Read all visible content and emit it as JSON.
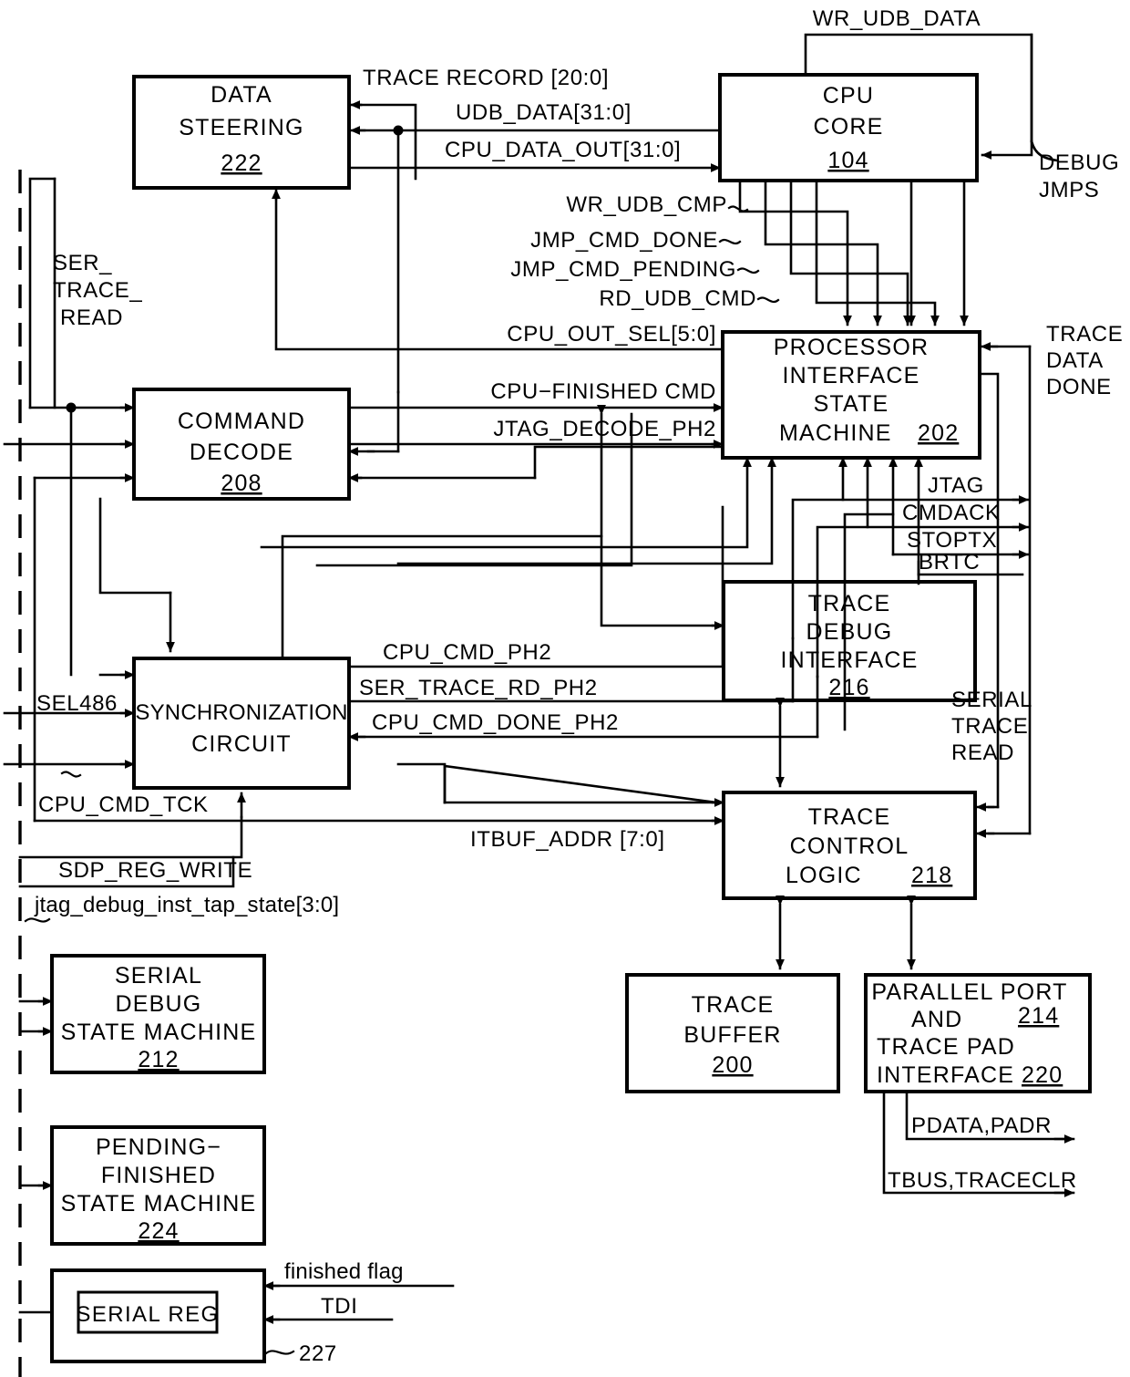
{
  "figure": {
    "title": "Processor debug and trace interface block diagram"
  },
  "blocks": {
    "data_steering": {
      "l1": "DATA",
      "l2": "STEERING",
      "num": "222"
    },
    "cpu_core": {
      "l1": "CPU",
      "l2": "CORE",
      "num": "104"
    },
    "command_decode": {
      "l1": "COMMAND",
      "l2": "DECODE",
      "num": "208"
    },
    "pism": {
      "l1": "PROCESSOR",
      "l2": "INTERFACE",
      "l3": "STATE",
      "l4": "MACHINE",
      "num": "202"
    },
    "sync_circuit": {
      "l1": "SYNCHRONIZATION",
      "l2": "CIRCUIT"
    },
    "trace_debug_if": {
      "l1": "TRACE",
      "l2": "DEBUG",
      "l3": "INTERFACE",
      "num": "216"
    },
    "trace_ctrl_logic": {
      "l1": "TRACE",
      "l2": "CONTROL",
      "l3": "LOGIC",
      "num": "218"
    },
    "trace_buffer": {
      "l1": "TRACE",
      "l2": "BUFFER",
      "num": "200"
    },
    "parallel_port": {
      "l1": "PARALLEL PORT",
      "l2": "AND",
      "num1": "214",
      "l3": "TRACE PAD",
      "l4": "INTERFACE",
      "num2": "220"
    },
    "serial_debug_sm": {
      "l1": "SERIAL",
      "l2": "DEBUG",
      "l3": "STATE MACHINE",
      "num": "212"
    },
    "pending_sm": {
      "l1": "PENDING−",
      "l2": "FINISHED",
      "l3": "STATE MACHINE",
      "num": "224"
    },
    "serial_reg_box": {
      "label": "SERIAL REG",
      "num": "227"
    }
  },
  "signals": {
    "wr_udb_data": "WR_UDB_DATA",
    "trace_record": "TRACE RECORD [20:0]",
    "udb_data": "UDB_DATA[31:0]",
    "cpu_data_out": "CPU_DATA_OUT[31:0]",
    "debug_jmps_1": "DEBUG",
    "debug_jmps_2": "JMPS",
    "wr_udb_cmp": "WR_UDB_CMP",
    "jmp_cmd_done": "JMP_CMD_DONE",
    "jmp_cmd_pending": "JMP_CMD_PENDING",
    "rd_udb_cmd": "RD_UDB_CMD",
    "cpu_out_sel": "CPU_OUT_SEL[5:0]",
    "cpu_finished_cmd": "CPU−FINISHED CMD",
    "jtag_decode_ph2": "JTAG_DECODE_PH2",
    "ser_trace_read_1": "SER_",
    "ser_trace_read_2": "TRACE_",
    "ser_trace_read_3": "READ",
    "trace_data_done_1": "TRACE",
    "trace_data_done_2": "DATA",
    "trace_data_done_3": "DONE",
    "jtag": "JTAG",
    "cmdack": "CMDACK",
    "stoptx": "STOPTX",
    "brtc": "BRTC",
    "cpu_cmd_ph2": "CPU_CMD_PH2",
    "ser_trace_rd_ph2": "SER_TRACE_RD_PH2",
    "cpu_cmd_done_ph2": "CPU_CMD_DONE_PH2",
    "sel486": "SEL486",
    "cpu_cmd_tck": "CPU_CMD_TCK",
    "serial_trace_read_1": "SERIAL",
    "serial_trace_read_2": "TRACE",
    "serial_trace_read_3": "READ",
    "itbuf_addr": "ITBUF_ADDR [7:0]",
    "sdp_reg_write": "SDP_REG_WRITE",
    "jtag_tap_state": "jtag_debug_inst_tap_state[3:0]",
    "pdata_padr": "PDATA,PADR",
    "tbus_traceclr": "TBUS,TRACECLR",
    "finished_flag": "finished flag",
    "tdi": "TDI"
  }
}
